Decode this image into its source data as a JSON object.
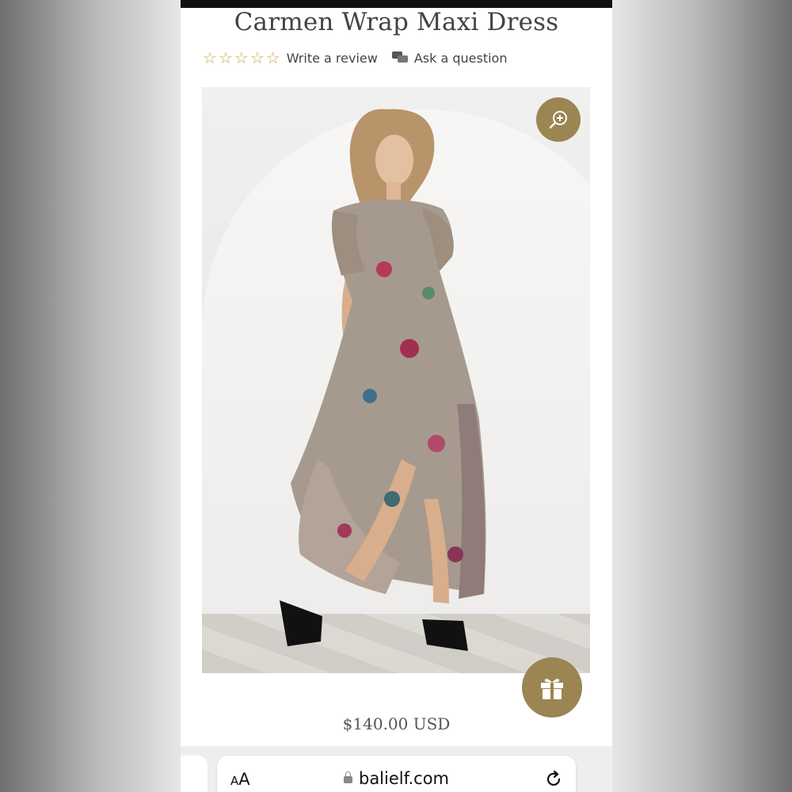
{
  "product": {
    "title": "Carmen Wrap Maxi Dress",
    "rating_stars": 0,
    "rating_max": 5,
    "write_review": "Write a review",
    "ask_question": "Ask a question",
    "price": "$140.00 USD"
  },
  "browser": {
    "text_size_label_small": "A",
    "text_size_label_large": "A",
    "url": "balielf.com"
  },
  "colors": {
    "accent": "#9b8552",
    "star": "#c9a94b",
    "text": "#444444"
  },
  "icons": {
    "zoom": "zoom-in-icon",
    "gift": "gift-icon",
    "lock": "lock-icon",
    "reload": "reload-icon",
    "chat": "chat-bubbles-icon"
  }
}
